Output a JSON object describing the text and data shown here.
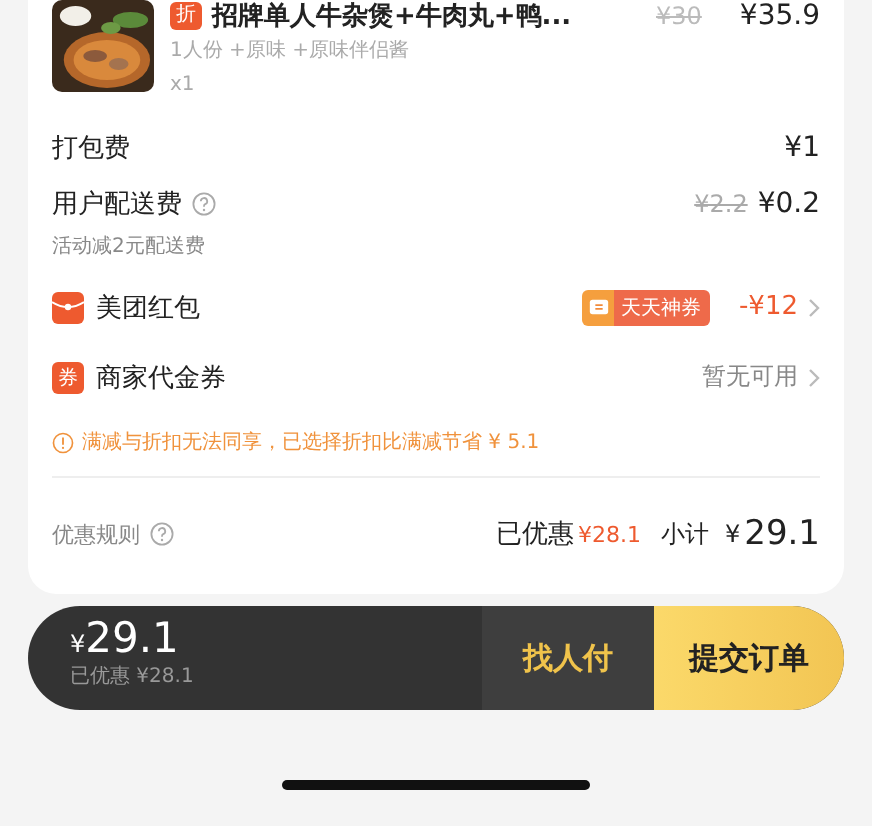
{
  "item": {
    "badge": "折",
    "name": "招牌单人牛杂煲+牛肉丸+鸭...",
    "original_price": "¥30",
    "price": "¥35.9",
    "specs": "1人份 +原味 +原味伴侣酱",
    "quantity": "x1"
  },
  "fees": [
    {
      "label": "打包费",
      "has_help": false,
      "value": "¥1"
    },
    {
      "label": "用户配送费",
      "has_help": true,
      "original": "¥2.2",
      "value": "¥0.2"
    }
  ],
  "fee_note": "活动减2元配送费",
  "coupons": [
    {
      "kind": "redpacket",
      "label": "美团红包",
      "tag": "天天神券",
      "value": "-¥12",
      "highlight": true
    },
    {
      "kind": "voucher",
      "icon_text": "券",
      "label": "商家代金券",
      "value": "暂无可用",
      "highlight": false
    }
  ],
  "warning": "满减与折扣无法同享，已选择折扣比满减节省 ¥ 5.1",
  "summary": {
    "rules": "优惠规则",
    "discount_label": "已优惠",
    "discount": "¥28.1",
    "subtotal_label": "小计",
    "subtotal": "29.1",
    "currency": "¥"
  },
  "bar": {
    "currency": "¥",
    "total": "29.1",
    "discount": "已优惠 ¥28.1",
    "pay_for_me": "找人付",
    "submit": "提交订单"
  }
}
